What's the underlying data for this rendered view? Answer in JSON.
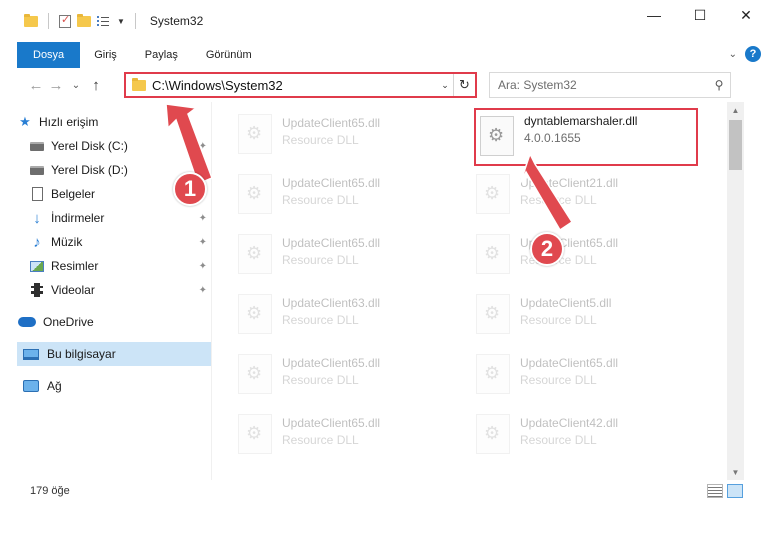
{
  "window": {
    "title": "System32",
    "minimize": "—",
    "maximize": "☐",
    "close": "✕"
  },
  "ribbon": {
    "tabs": [
      "Dosya",
      "Giriş",
      "Paylaş",
      "Görünüm"
    ],
    "help": "?",
    "collapse": "⌄"
  },
  "nav": {
    "back": "←",
    "forward": "→",
    "recent": "⌄",
    "up": "↑",
    "address": "C:\\Windows\\System32",
    "address_dropdown": "⌄",
    "refresh": "↻",
    "search_placeholder": "Ara: System32",
    "search_icon": "⚲"
  },
  "sidebar": {
    "items": [
      {
        "label": "Hızlı erişim",
        "icon": "star-icon"
      },
      {
        "label": "Yerel Disk (C:)",
        "icon": "drive-icon",
        "pinned": true
      },
      {
        "label": "Yerel Disk (D:)",
        "icon": "drive-icon",
        "pinned": true
      },
      {
        "label": "Belgeler",
        "icon": "document-icon",
        "pinned": true
      },
      {
        "label": "İndirmeler",
        "icon": "download-icon",
        "pinned": true
      },
      {
        "label": "Müzik",
        "icon": "music-icon",
        "pinned": true
      },
      {
        "label": "Resimler",
        "icon": "pictures-icon",
        "pinned": true
      },
      {
        "label": "Videolar",
        "icon": "videos-icon",
        "pinned": true
      },
      {
        "label": "OneDrive",
        "icon": "cloud-icon"
      },
      {
        "label": "Bu bilgisayar",
        "icon": "computer-icon",
        "selected": true
      },
      {
        "label": "Ağ",
        "icon": "network-icon"
      }
    ],
    "pin_glyph": "📌"
  },
  "files": {
    "highlight": {
      "name": "dyntablemarshaler.dll",
      "desc": "4.0.0.1655"
    },
    "left_column": [
      {
        "name": "UpdateClient65.dll",
        "desc": "Resource DLL"
      },
      {
        "name": "UpdateClient65.dll",
        "desc": "Resource DLL"
      },
      {
        "name": "UpdateClient65.dll",
        "desc": "Resource DLL"
      },
      {
        "name": "UpdateClient63.dll",
        "desc": "Resource DLL"
      },
      {
        "name": "UpdateClient65.dll",
        "desc": "Resource DLL"
      },
      {
        "name": "UpdateClient65.dll",
        "desc": "Resource DLL"
      }
    ],
    "right_column": [
      {
        "name": "UpdateClient21.dll",
        "desc": "Resource DLL"
      },
      {
        "name": "UpdateClient65.dll",
        "desc": "Resource DLL"
      },
      {
        "name": "UpdateClient5.dll",
        "desc": "Resource DLL"
      },
      {
        "name": "UpdateClient65.dll",
        "desc": "Resource DLL"
      },
      {
        "name": "UpdateClient42.dll",
        "desc": "Resource DLL"
      }
    ]
  },
  "status": {
    "count": "179 öğe"
  },
  "annotations": {
    "step1": "1",
    "step2": "2",
    "color": "#e0494f"
  }
}
